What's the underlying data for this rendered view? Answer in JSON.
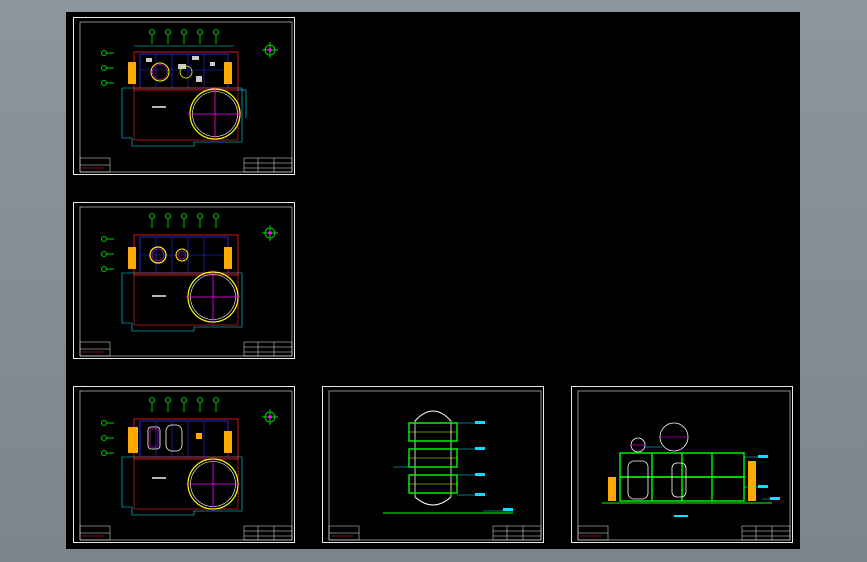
{
  "viewport": {
    "background": "#000000"
  },
  "colors": {
    "sheet_border": "#e8e8e8",
    "green": "#00ff00",
    "cyan": "#00e5ff",
    "blue": "#2233ff",
    "red": "#ff2020",
    "yellow": "#ffff00",
    "magenta": "#ff00ff",
    "orange": "#ffaa00",
    "white": "#ffffff"
  },
  "sheets": [
    {
      "id": "plan-1",
      "kind": "plan",
      "variant": 1
    },
    {
      "id": "plan-2",
      "kind": "plan",
      "variant": 2
    },
    {
      "id": "plan-3",
      "kind": "plan",
      "variant": 3
    },
    {
      "id": "elevation-1",
      "kind": "elevation-tower"
    },
    {
      "id": "elevation-2",
      "kind": "elevation-frame"
    }
  ]
}
